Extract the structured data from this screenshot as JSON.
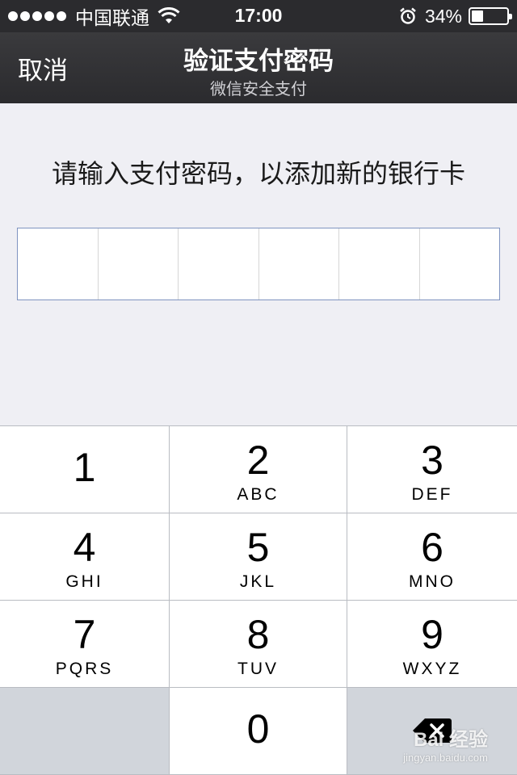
{
  "status_bar": {
    "carrier": "中国联通",
    "time": "17:00",
    "battery_text": "34%",
    "battery_level": 0.34,
    "icons": [
      "signal-dots-icon",
      "wifi-icon",
      "alarm-icon",
      "battery-icon"
    ]
  },
  "nav": {
    "cancel_label": "取消",
    "title": "验证支付密码",
    "subtitle": "微信安全支付"
  },
  "prompt": "请输入支付密码，以添加新的银行卡",
  "password": {
    "digits": 6,
    "entered": 0
  },
  "keypad": {
    "keys": [
      {
        "num": "1",
        "letters": ""
      },
      {
        "num": "2",
        "letters": "ABC"
      },
      {
        "num": "3",
        "letters": "DEF"
      },
      {
        "num": "4",
        "letters": "GHI"
      },
      {
        "num": "5",
        "letters": "JKL"
      },
      {
        "num": "6",
        "letters": "MNO"
      },
      {
        "num": "7",
        "letters": "PQRS"
      },
      {
        "num": "8",
        "letters": "TUV"
      },
      {
        "num": "9",
        "letters": "WXYZ"
      },
      {
        "num": "0",
        "letters": ""
      }
    ],
    "delete_icon": "backspace-icon"
  },
  "watermark": {
    "main": "Bai 经验",
    "sub": "jingyan.baidu.com"
  }
}
